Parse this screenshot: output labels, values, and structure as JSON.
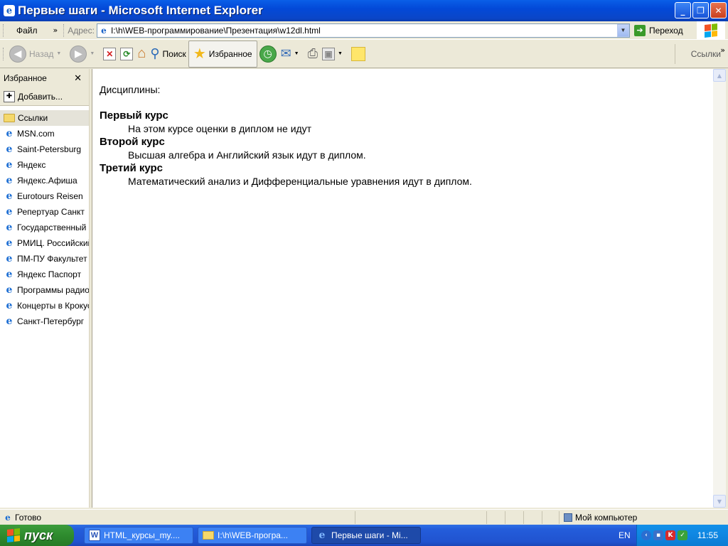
{
  "window": {
    "title": "Первые шаги - Microsoft Internet Explorer"
  },
  "menubar": {
    "items": [
      "Файл"
    ],
    "address_label": "Адрес:",
    "address_value": "I:\\h\\WEB-программирование\\Презентация\\w12dl.html",
    "go_label": "Переход"
  },
  "toolbar": {
    "back_label": "Назад",
    "search_label": "Поиск",
    "favorites_label": "Избранное",
    "links_label": "Ссылки"
  },
  "favorites": {
    "header": "Избранное",
    "add_label": "Добавить...",
    "items": [
      "Ссылки",
      "MSN.com",
      "Saint-Petersburg",
      "Яндекс",
      "Яндекс.Афиша",
      "Eurotours Reisen",
      "Репертуар Санкт",
      "Государственный",
      "РМИЦ. Российский",
      "ПМ-ПУ  Факультет",
      "Яндекс Паспорт",
      "Программы радио",
      "Концерты в Крокус",
      "Санкт-Петербург"
    ]
  },
  "content": {
    "intro": "Дисциплины:",
    "courses": [
      {
        "title": "Первый курс",
        "desc": "На этом курсе оценки в диплом не идут"
      },
      {
        "title": "Второй курс",
        "desc": "Высшая алгебра и Английский язык идут в диплом."
      },
      {
        "title": "Третий курс",
        "desc": "Математический анализ и Дифференциальные уравнения идут в диплом."
      }
    ]
  },
  "statusbar": {
    "status_text": "Готово",
    "zone_text": "Мой компьютер"
  },
  "taskbar": {
    "start_label": "пуск",
    "tasks": [
      "HTML_курсы_my....",
      "I:\\h\\WEB-програ...",
      "Первые шаги - Mi..."
    ],
    "lang": "EN",
    "clock": "11:55"
  },
  "colors": {
    "titlebar": "#0a5fe8",
    "taskbar": "#245ddb",
    "start": "#2e8b2e"
  }
}
